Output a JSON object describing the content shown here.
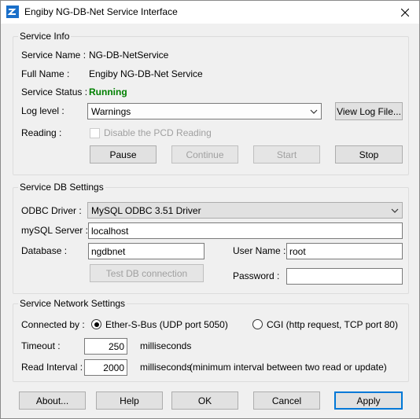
{
  "window": {
    "title": "Engiby NG-DB-Net Service Interface",
    "icon": "app-icon",
    "close_icon": "close-icon"
  },
  "service_info": {
    "legend": "Service Info",
    "service_name_label": "Service Name :",
    "service_name_value": "NG-DB-NetService",
    "full_name_label": "Full Name :",
    "full_name_value": "Engiby NG-DB-Net Service",
    "status_label": "Service Status :",
    "status_value": "Running",
    "status_color": "#008000",
    "log_level_label": "Log level :",
    "log_level_selected": "Warnings",
    "view_log_button": "View Log File...",
    "reading_label": "Reading :",
    "disable_pcd_label": "Disable the PCD Reading",
    "disable_pcd_checked": false,
    "buttons": {
      "pause": "Pause",
      "continue": "Continue",
      "start": "Start",
      "stop": "Stop"
    }
  },
  "db_settings": {
    "legend": "Service DB Settings",
    "odbc_label": "ODBC Driver :",
    "odbc_selected": "MySQL ODBC 3.51 Driver",
    "mysql_server_label": "mySQL Server :",
    "mysql_server_value": "localhost",
    "database_label": "Database :",
    "database_value": "ngdbnet",
    "username_label": "User Name :",
    "username_value": "root",
    "password_label": "Password :",
    "password_value": "",
    "test_button": "Test DB connection"
  },
  "network_settings": {
    "legend": "Service Network Settings",
    "connected_label": "Connected by :",
    "option_ether": "Ether-S-Bus (UDP port 5050)",
    "option_cgi": "CGI (http request, TCP port 80)",
    "selected_option": "ether",
    "timeout_label": "Timeout :",
    "timeout_value": "250",
    "timeout_unit": "milliseconds",
    "read_interval_label": "Read Interval :",
    "read_interval_value": "2000",
    "read_interval_unit": "milliseconds",
    "read_interval_note": "(minimum interval between two read or update)"
  },
  "footer": {
    "about": "About...",
    "help": "Help",
    "ok": "OK",
    "cancel": "Cancel",
    "apply": "Apply"
  },
  "colors": {
    "accent": "#0078d7",
    "window_bg": "#f0f0f0"
  }
}
